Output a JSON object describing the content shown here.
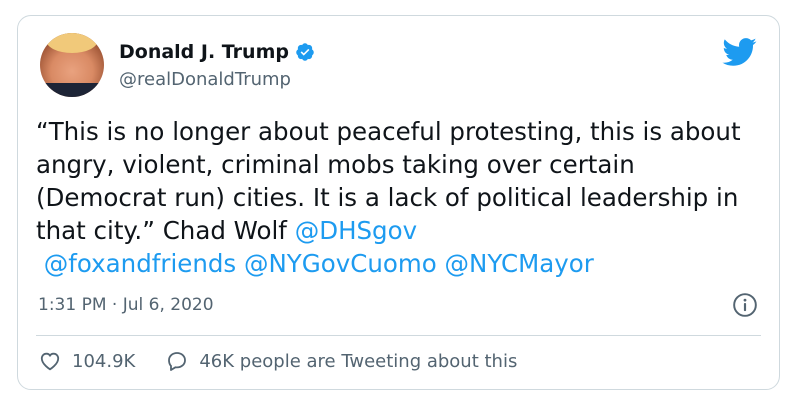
{
  "author": {
    "name": "Donald J. Trump",
    "handle": "@realDonaldTrump"
  },
  "tweet": {
    "text": "“This is no longer about peaceful protesting, this is about angry, violent, criminal mobs taking over certain (Democrat run) cities. It is a lack of political leadership in that city.” Chad Wolf",
    "mentions": [
      "@DHSgov",
      "@foxandfriends",
      "@NYGovCuomo",
      "@NYCMayor"
    ],
    "timestamp": "1:31 PM · Jul 6, 2020"
  },
  "stats": {
    "likes": "104.9K",
    "tweeting_about": "46K people are Tweeting about this"
  },
  "icons": {
    "verified": "verified-badge-icon",
    "brand": "twitter-bird-icon",
    "info": "info-icon",
    "like": "heart-icon",
    "reply": "speech-bubble-icon"
  },
  "colors": {
    "link": "#1d9bf0",
    "text": "#0f1419",
    "muted": "#536471",
    "border": "#cfd9de"
  }
}
